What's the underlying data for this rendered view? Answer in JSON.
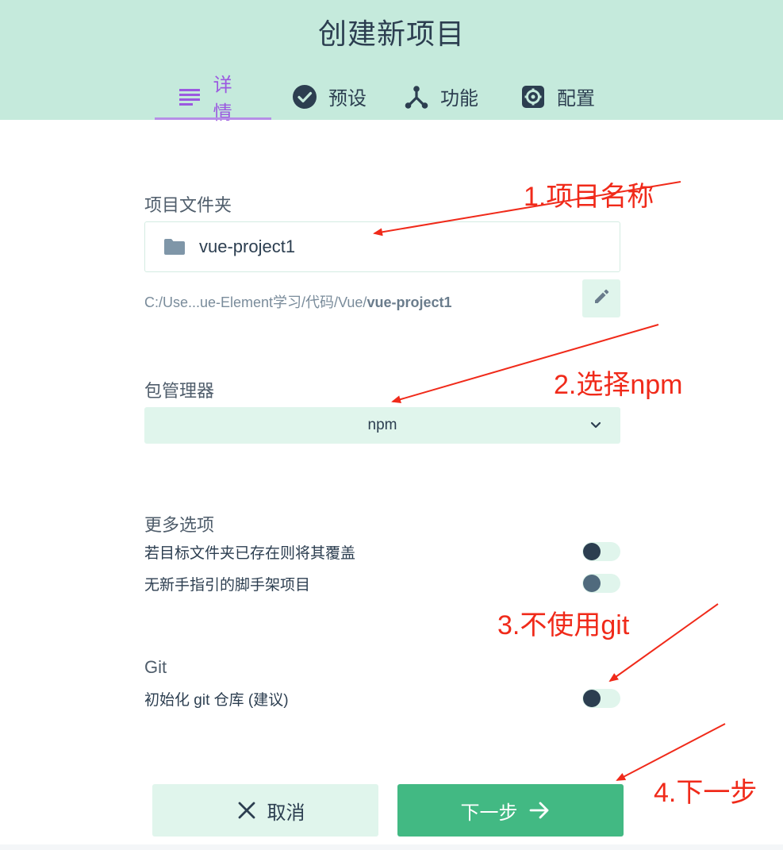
{
  "header": {
    "title": "创建新项目",
    "tabs": [
      {
        "label": "详情",
        "icon": "list-icon",
        "active": true
      },
      {
        "label": "预设",
        "icon": "check-circle-icon"
      },
      {
        "label": "功能",
        "icon": "fork-icon"
      },
      {
        "label": "配置",
        "icon": "gear-icon"
      }
    ]
  },
  "details": {
    "folder_label": "项目文件夹",
    "folder_value": "vue-project1",
    "path_prefix": "C:/Use...ue-Element学习/代码/Vue/",
    "path_bold": "vue-project1",
    "package_manager_label": "包管理器",
    "package_manager_value": "npm",
    "more_options_label": "更多选项",
    "options": [
      {
        "label": "若目标文件夹已存在则将其覆盖",
        "on": false
      },
      {
        "label": "无新手指引的脚手架项目",
        "on": false
      }
    ],
    "git_label": "Git",
    "git_option": {
      "label": "初始化 git 仓库 (建议)",
      "on": false
    }
  },
  "actions": {
    "cancel_label": "取消",
    "next_label": "下一步"
  },
  "annotations": {
    "a1": "1.项目名称",
    "a2": "2.选择npm",
    "a3": "3.不使用git",
    "a4": "4.下一步"
  },
  "colors": {
    "header_bg": "#c5eadc",
    "accent_purple": "#9b59e0",
    "primary_green": "#42b983",
    "light_green": "#e0f5ec",
    "annotation_red": "#f02a1a"
  }
}
